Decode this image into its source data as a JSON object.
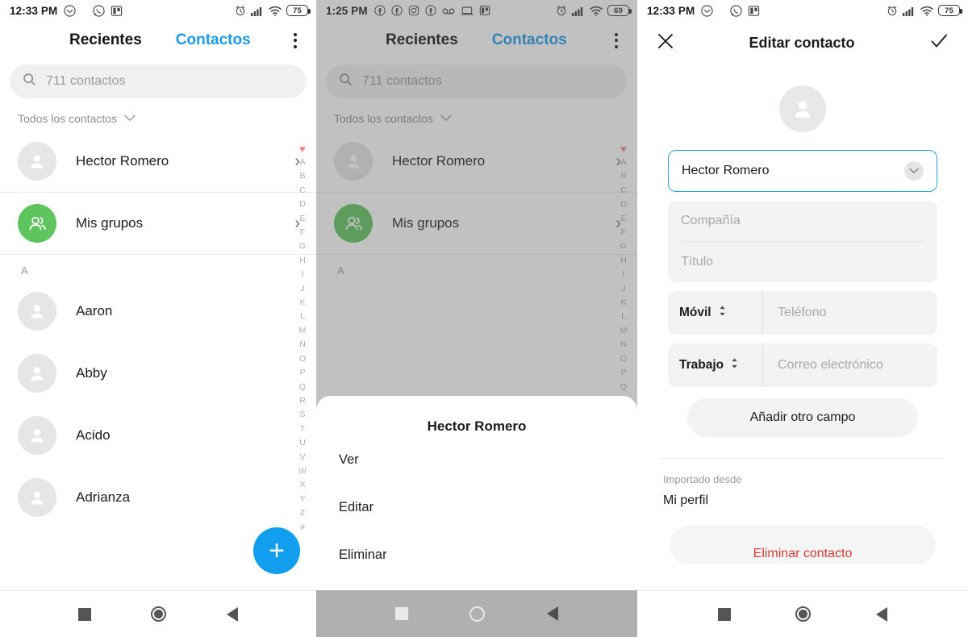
{
  "panel1": {
    "status": {
      "time": "12:33 PM",
      "left_icons": [
        "messenger-icon",
        "whatsapp-icon",
        "trello-icon"
      ],
      "right_icons": [
        "alarm-icon",
        "signal-icon",
        "wifi-icon"
      ],
      "battery": "75"
    },
    "tabs": [
      {
        "label": "Recientes",
        "active": false
      },
      {
        "label": "Contactos",
        "active": true
      }
    ],
    "overflow_icon": "kebab-menu-icon",
    "search_placeholder": "711 contactos",
    "filter_label": "Todos los contactos",
    "top_rows": [
      {
        "name": "Hector Romero",
        "avatar": "person-avatar"
      },
      {
        "name": "Mis grupos",
        "avatar": "group-avatar"
      }
    ],
    "section_header": "A",
    "contacts": [
      "Aaron",
      "Abby",
      "Acido",
      "Adrianza"
    ],
    "alpha_index": [
      "♥",
      "A",
      "B",
      "C",
      "D",
      "E",
      "F",
      "G",
      "H",
      "I",
      "J",
      "K",
      "L",
      "M",
      "N",
      "O",
      "P",
      "Q",
      "R",
      "S",
      "T",
      "U",
      "V",
      "W",
      "X",
      "Y",
      "Z",
      "#"
    ],
    "fab_label": "+"
  },
  "panel2": {
    "status": {
      "time": "1:25 PM",
      "left_icons": [
        "facebook-icon",
        "facebook-icon",
        "instagram-icon",
        "facebook-icon",
        "voicemail-icon",
        "laptop-icon",
        "trello-icon"
      ],
      "right_icons": [
        "alarm-icon",
        "signal-icon",
        "wifi-icon"
      ],
      "battery": "69"
    },
    "tabs": [
      {
        "label": "Recientes",
        "active": false
      },
      {
        "label": "Contactos",
        "active": true
      }
    ],
    "search_placeholder": "711 contactos",
    "filter_label": "Todos los contactos",
    "top_rows": [
      {
        "name": "Hector Romero",
        "avatar": "person-avatar"
      },
      {
        "name": "Mis grupos",
        "avatar": "group-avatar"
      }
    ],
    "section_header": "A",
    "sheet": {
      "title": "Hector Romero",
      "items": [
        "Ver",
        "Editar",
        "Eliminar"
      ]
    }
  },
  "panel3": {
    "status": {
      "time": "12:33 PM",
      "left_icons": [
        "messenger-icon",
        "whatsapp-icon",
        "trello-icon"
      ],
      "right_icons": [
        "alarm-icon",
        "signal-icon",
        "wifi-icon"
      ],
      "battery": "75"
    },
    "header": {
      "close_icon": "close-icon",
      "title": "Editar contacto",
      "confirm_icon": "check-icon"
    },
    "avatar": "person-avatar",
    "name_field": {
      "value": "Hector Romero",
      "expand_icon": "chevron-down-icon"
    },
    "company_placeholder": "Compañía",
    "title_placeholder": "Título",
    "phone_row": {
      "type": "Móvil",
      "placeholder": "Teléfono",
      "stepper_icon": "up-down-arrows-icon"
    },
    "email_row": {
      "type": "Trabajo",
      "placeholder": "Correo electrónico",
      "stepper_icon": "up-down-arrows-icon"
    },
    "add_field_label": "Añadir otro campo",
    "imported_label": "Importado desde",
    "imported_value": "Mi perfil",
    "delete_label": "Eliminar contacto"
  },
  "colors": {
    "accent_blue": "#1a9ced",
    "fab_blue": "#119eef",
    "group_green": "#5ec45e",
    "heart_pink": "#f1878f",
    "delete_red": "#d83a2e",
    "field_border": "#2aa7e0"
  },
  "navbar": {
    "recents_icon": "square-icon",
    "home_icon": "circle-icon",
    "back_icon": "triangle-back-icon"
  }
}
